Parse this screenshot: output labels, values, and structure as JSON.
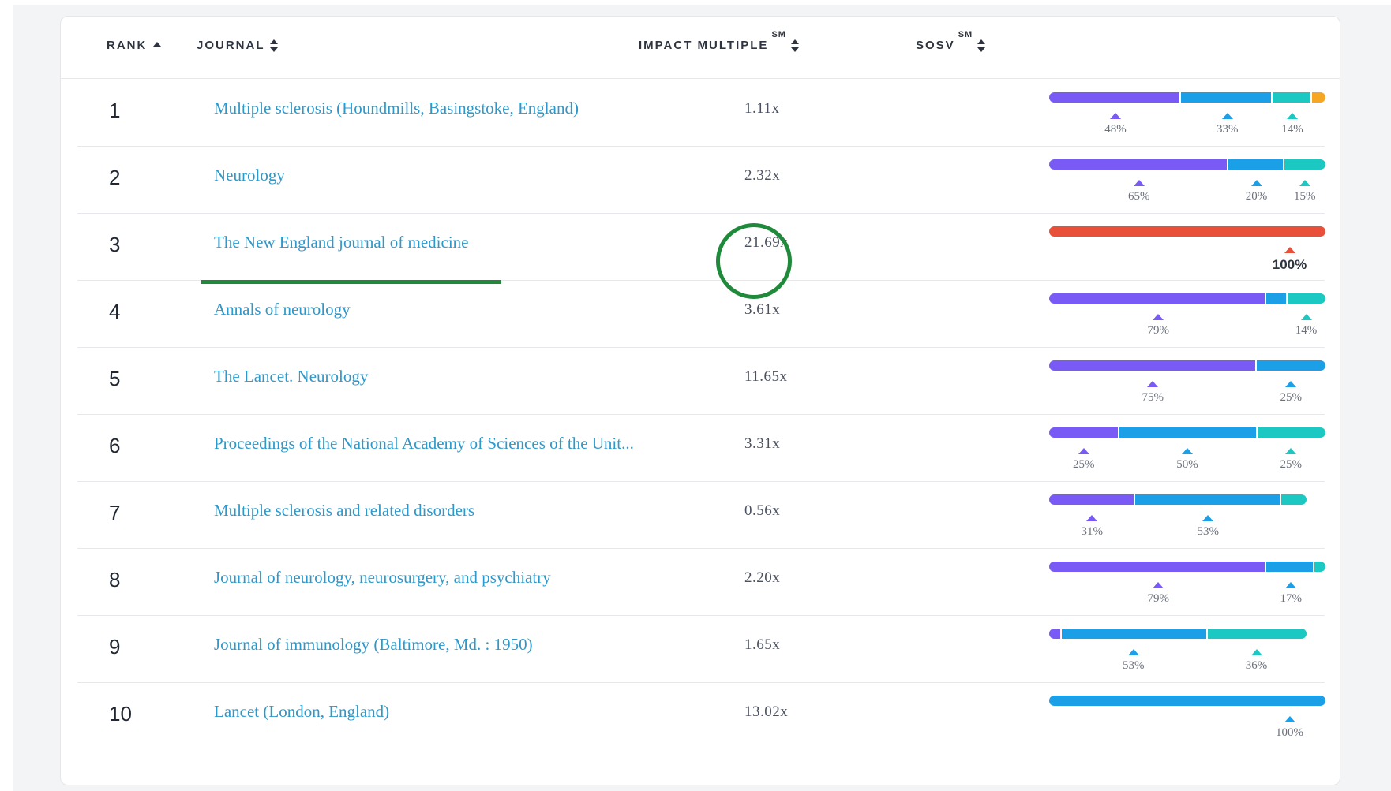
{
  "headers": {
    "rank": "RANK",
    "journal": "JOURNAL",
    "impact": "IMPACT MULTIPLE",
    "impact_sup": "SM",
    "sosv": "SOSV",
    "sosv_sup": "SM"
  },
  "colors": {
    "purple": "#7a5af5",
    "blue": "#1ba0e8",
    "teal": "#1cc9c2",
    "orange": "#f5a623",
    "red": "#e8503a",
    "link": "#2d98c9",
    "annotation_green": "#1e8a3a"
  },
  "rows": [
    {
      "rank": "1",
      "journal": "Multiple sclerosis (Houndmills, Basingstoke, England)",
      "impact": "1.11x",
      "segments": [
        {
          "color": "purple",
          "value": 48
        },
        {
          "color": "blue",
          "value": 33
        },
        {
          "color": "teal",
          "value": 14
        },
        {
          "color": "orange",
          "value": 5
        }
      ],
      "labels": [
        {
          "color": "purple",
          "text": "48%"
        },
        {
          "color": "blue",
          "text": "33%"
        },
        {
          "color": "teal",
          "text": "14%"
        }
      ]
    },
    {
      "rank": "2",
      "journal": "Neurology",
      "impact": "2.32x",
      "segments": [
        {
          "color": "purple",
          "value": 65
        },
        {
          "color": "blue",
          "value": 20
        },
        {
          "color": "teal",
          "value": 15
        }
      ],
      "labels": [
        {
          "color": "purple",
          "text": "65%"
        },
        {
          "color": "blue",
          "text": "20%"
        },
        {
          "color": "teal",
          "text": "15%"
        }
      ]
    },
    {
      "rank": "3",
      "journal": "The New England journal of medicine",
      "impact": "21.69x",
      "segments": [
        {
          "color": "red",
          "value": 100
        }
      ],
      "labels": [
        {
          "color": "red",
          "text": "100%",
          "bold": true
        }
      ]
    },
    {
      "rank": "4",
      "journal": "Annals of neurology",
      "impact": "3.61x",
      "segments": [
        {
          "color": "purple",
          "value": 79
        },
        {
          "color": "blue",
          "value": 7
        },
        {
          "color": "teal",
          "value": 14
        }
      ],
      "labels": [
        {
          "color": "purple",
          "text": "79%"
        },
        {
          "color": "teal",
          "text": "14%"
        }
      ]
    },
    {
      "rank": "5",
      "journal": "The Lancet. Neurology",
      "impact": "11.65x",
      "segments": [
        {
          "color": "purple",
          "value": 75
        },
        {
          "color": "blue",
          "value": 25
        }
      ],
      "labels": [
        {
          "color": "purple",
          "text": "75%"
        },
        {
          "color": "blue",
          "text": "25%"
        }
      ]
    },
    {
      "rank": "6",
      "journal": "Proceedings of the National Academy of Sciences of the Unit...",
      "impact": "3.31x",
      "segments": [
        {
          "color": "purple",
          "value": 25
        },
        {
          "color": "blue",
          "value": 50
        },
        {
          "color": "teal",
          "value": 25
        }
      ],
      "labels": [
        {
          "color": "purple",
          "text": "25%"
        },
        {
          "color": "blue",
          "text": "50%"
        },
        {
          "color": "teal",
          "text": "25%"
        }
      ]
    },
    {
      "rank": "7",
      "journal": "Multiple sclerosis and related disorders",
      "impact": "0.56x",
      "segments": [
        {
          "color": "purple",
          "value": 31
        },
        {
          "color": "blue",
          "value": 53
        },
        {
          "color": "teal",
          "value": 9
        }
      ],
      "labels": [
        {
          "color": "purple",
          "text": "31%"
        },
        {
          "color": "blue",
          "text": "53%"
        }
      ]
    },
    {
      "rank": "8",
      "journal": "Journal of neurology, neurosurgery, and psychiatry",
      "impact": "2.20x",
      "segments": [
        {
          "color": "purple",
          "value": 79
        },
        {
          "color": "blue",
          "value": 17
        },
        {
          "color": "teal",
          "value": 4
        }
      ],
      "labels": [
        {
          "color": "purple",
          "text": "79%"
        },
        {
          "color": "blue",
          "text": "17%"
        }
      ]
    },
    {
      "rank": "9",
      "journal": "Journal of immunology (Baltimore, Md. : 1950)",
      "impact": "1.65x",
      "segments": [
        {
          "color": "purple",
          "value": 4
        },
        {
          "color": "blue",
          "value": 53
        },
        {
          "color": "teal",
          "value": 36
        }
      ],
      "labels": [
        {
          "color": "blue",
          "text": "53%"
        },
        {
          "color": "teal",
          "text": "36%"
        }
      ]
    },
    {
      "rank": "10",
      "journal": "Lancet (London, England)",
      "impact": "13.02x",
      "segments": [
        {
          "color": "blue",
          "value": 100
        }
      ],
      "labels": [
        {
          "color": "blue",
          "text": "100%"
        }
      ]
    }
  ]
}
